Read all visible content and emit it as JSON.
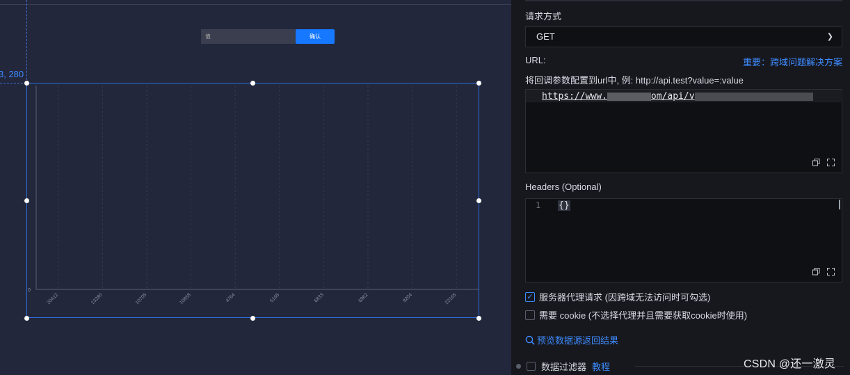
{
  "canvas": {
    "coords_label": "3, 280",
    "input_placeholder": "值",
    "confirm_label": "确认"
  },
  "chart_data": {
    "type": "bar",
    "categories": [
      "20412",
      "13280",
      "10705",
      "10858",
      "4764",
      "5165",
      "6833",
      "6962",
      "9204",
      "22165"
    ],
    "values": [
      0,
      0,
      0,
      0,
      0,
      0,
      0,
      0,
      0,
      0
    ],
    "y_tick_label": "0",
    "grid": "vertical dashed"
  },
  "panel": {
    "request_method_label": "请求方式",
    "request_method_value": "GET",
    "url_label": "URL:",
    "cors_link": "重要：跨域问题解决方案",
    "url_hint": "将回调参数配置到url中, 例: http://api.test?value=:value",
    "url_part_1": "https://www.",
    "url_part_2": "om/api/v",
    "headers_label": "Headers (Optional)",
    "headers_line_no": "1",
    "headers_code": "{}",
    "proxy_label": "服务器代理请求 (因跨域无法访问时可勾选)",
    "proxy_checked": true,
    "cookie_label": "需要 cookie (不选择代理并且需要获取cookie时使用)",
    "cookie_checked": false,
    "preview_label": "预览数据源返回结果",
    "filter_label": "数据过滤器",
    "tutorial_label": "教程",
    "accent_color": "#3d8bff"
  },
  "watermark": "CSDN @还一激灵"
}
